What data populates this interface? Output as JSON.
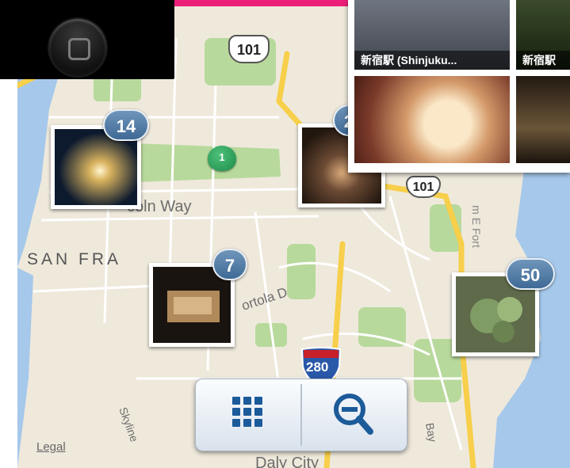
{
  "map": {
    "city_label": "SAN FRANCISCO",
    "city_visible": "SAN FRA",
    "street_labels": {
      "lincoln_way": "coln Way",
      "portola": "ortola D",
      "daly_city": "Daly City",
      "skyline": "Skyline",
      "bay": "Bay",
      "forty": "m E Fort"
    },
    "highway_101_top": "101",
    "highway_101_mid": "101",
    "interstate_280": "280",
    "legal_link": "Legal"
  },
  "clusters": [
    {
      "count": "14",
      "name": "cluster-14"
    },
    {
      "count": "2",
      "name": "cluster-2"
    },
    {
      "count": "7",
      "name": "cluster-7"
    },
    {
      "count": "50",
      "name": "cluster-50"
    }
  ],
  "green_pin": {
    "label": "1"
  },
  "popup": {
    "captions": [
      "新宿駅 (Shinjuku...",
      "新宿駅"
    ]
  },
  "controls": {
    "grid_icon": "grid-icon",
    "zoom_out_icon": "zoom-out-icon"
  },
  "colors": {
    "accent_top": "#ec1e79",
    "badge": "#4f78a2",
    "park": "#b8d99c",
    "water": "#a6c8ea",
    "highway": "#f7cf4a"
  }
}
